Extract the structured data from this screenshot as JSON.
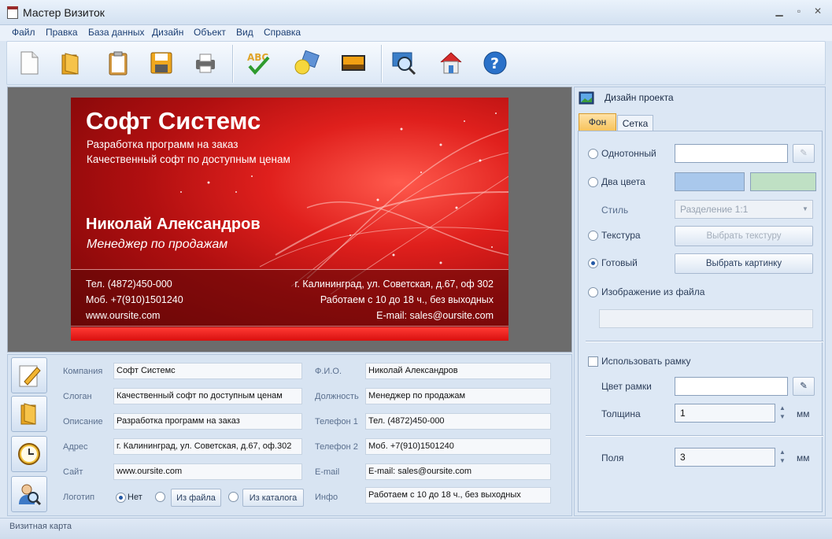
{
  "window": {
    "title": "Мастер Визиток"
  },
  "menu": [
    "Файл",
    "Правка",
    "База данных",
    "Дизайн",
    "Объект",
    "Вид",
    "Справка"
  ],
  "toolbar": [
    "new-document-icon",
    "open-folder-icon",
    "clipboard-icon",
    "save-icon",
    "print-icon",
    "spellcheck-icon",
    "shapes-icon",
    "image-icon",
    "zoom-icon",
    "home-icon",
    "help-icon"
  ],
  "card": {
    "company": "Софт Системс",
    "line1": "Разработка программ на заказ",
    "line2": "Качественный софт по доступным ценам",
    "name": "Николай Александров",
    "position": "Менеджер по продажам",
    "phone": "Тел. (4872)450-000",
    "mobile": "Моб. +7(910)1501240",
    "site": "www.oursite.com",
    "address": "г. Калининград, ул. Советская, д.67, оф 302",
    "hours": "Работаем с 10 до 18 ч., без выходных",
    "email": "E-mail: sales@oursite.com"
  },
  "form": {
    "company_label": "Компания",
    "company": "Софт Системс",
    "slogan_label": "Слоган",
    "slogan": "Качественный софт по доступным ценам",
    "desc_label": "Описание",
    "desc": "Разработка программ на заказ",
    "address_label": "Адрес",
    "address": "г. Калининград, ул. Советская, д.67, оф.302",
    "site_label": "Сайт",
    "site": "www.oursite.com",
    "logo_label": "Логотип",
    "logo_none": "Нет",
    "logo_file": "Из файла",
    "logo_catalog": "Из каталога",
    "fio_label": "Ф.И.О.",
    "fio": "Николай Александров",
    "position_label": "Должность",
    "position": "Менеджер по продажам",
    "phone1_label": "Телефон 1",
    "phone1": "Тел. (4872)450-000",
    "phone2_label": "Телефон 2",
    "phone2": "Моб. +7(910)1501240",
    "email_label": "E-mail",
    "email": "E-mail: sales@oursite.com",
    "info_label": "Инфо",
    "info": "Работаем с 10 до 18 ч., без выходных"
  },
  "panel": {
    "title": "Дизайн проекта",
    "tab_bg": "Фон",
    "tab_grid": "Сетка",
    "solid": "Однотонный",
    "two_colors": "Два цвета",
    "style_label": "Стиль",
    "style_value": "Разделение 1:1",
    "texture": "Текстура",
    "texture_btn": "Выбрать текстуру",
    "ready": "Готовый",
    "ready_btn": "Выбрать картинку",
    "from_file": "Изображение из файла",
    "use_frame": "Использовать рамку",
    "frame_color": "Цвет рамки",
    "thickness": "Толщина",
    "thickness_value": "1",
    "unit": "мм",
    "margins": "Поля",
    "margins_value": "3",
    "color1": "#a9c8ec",
    "color2": "#bfe0c4"
  },
  "status": "Визитная карта"
}
